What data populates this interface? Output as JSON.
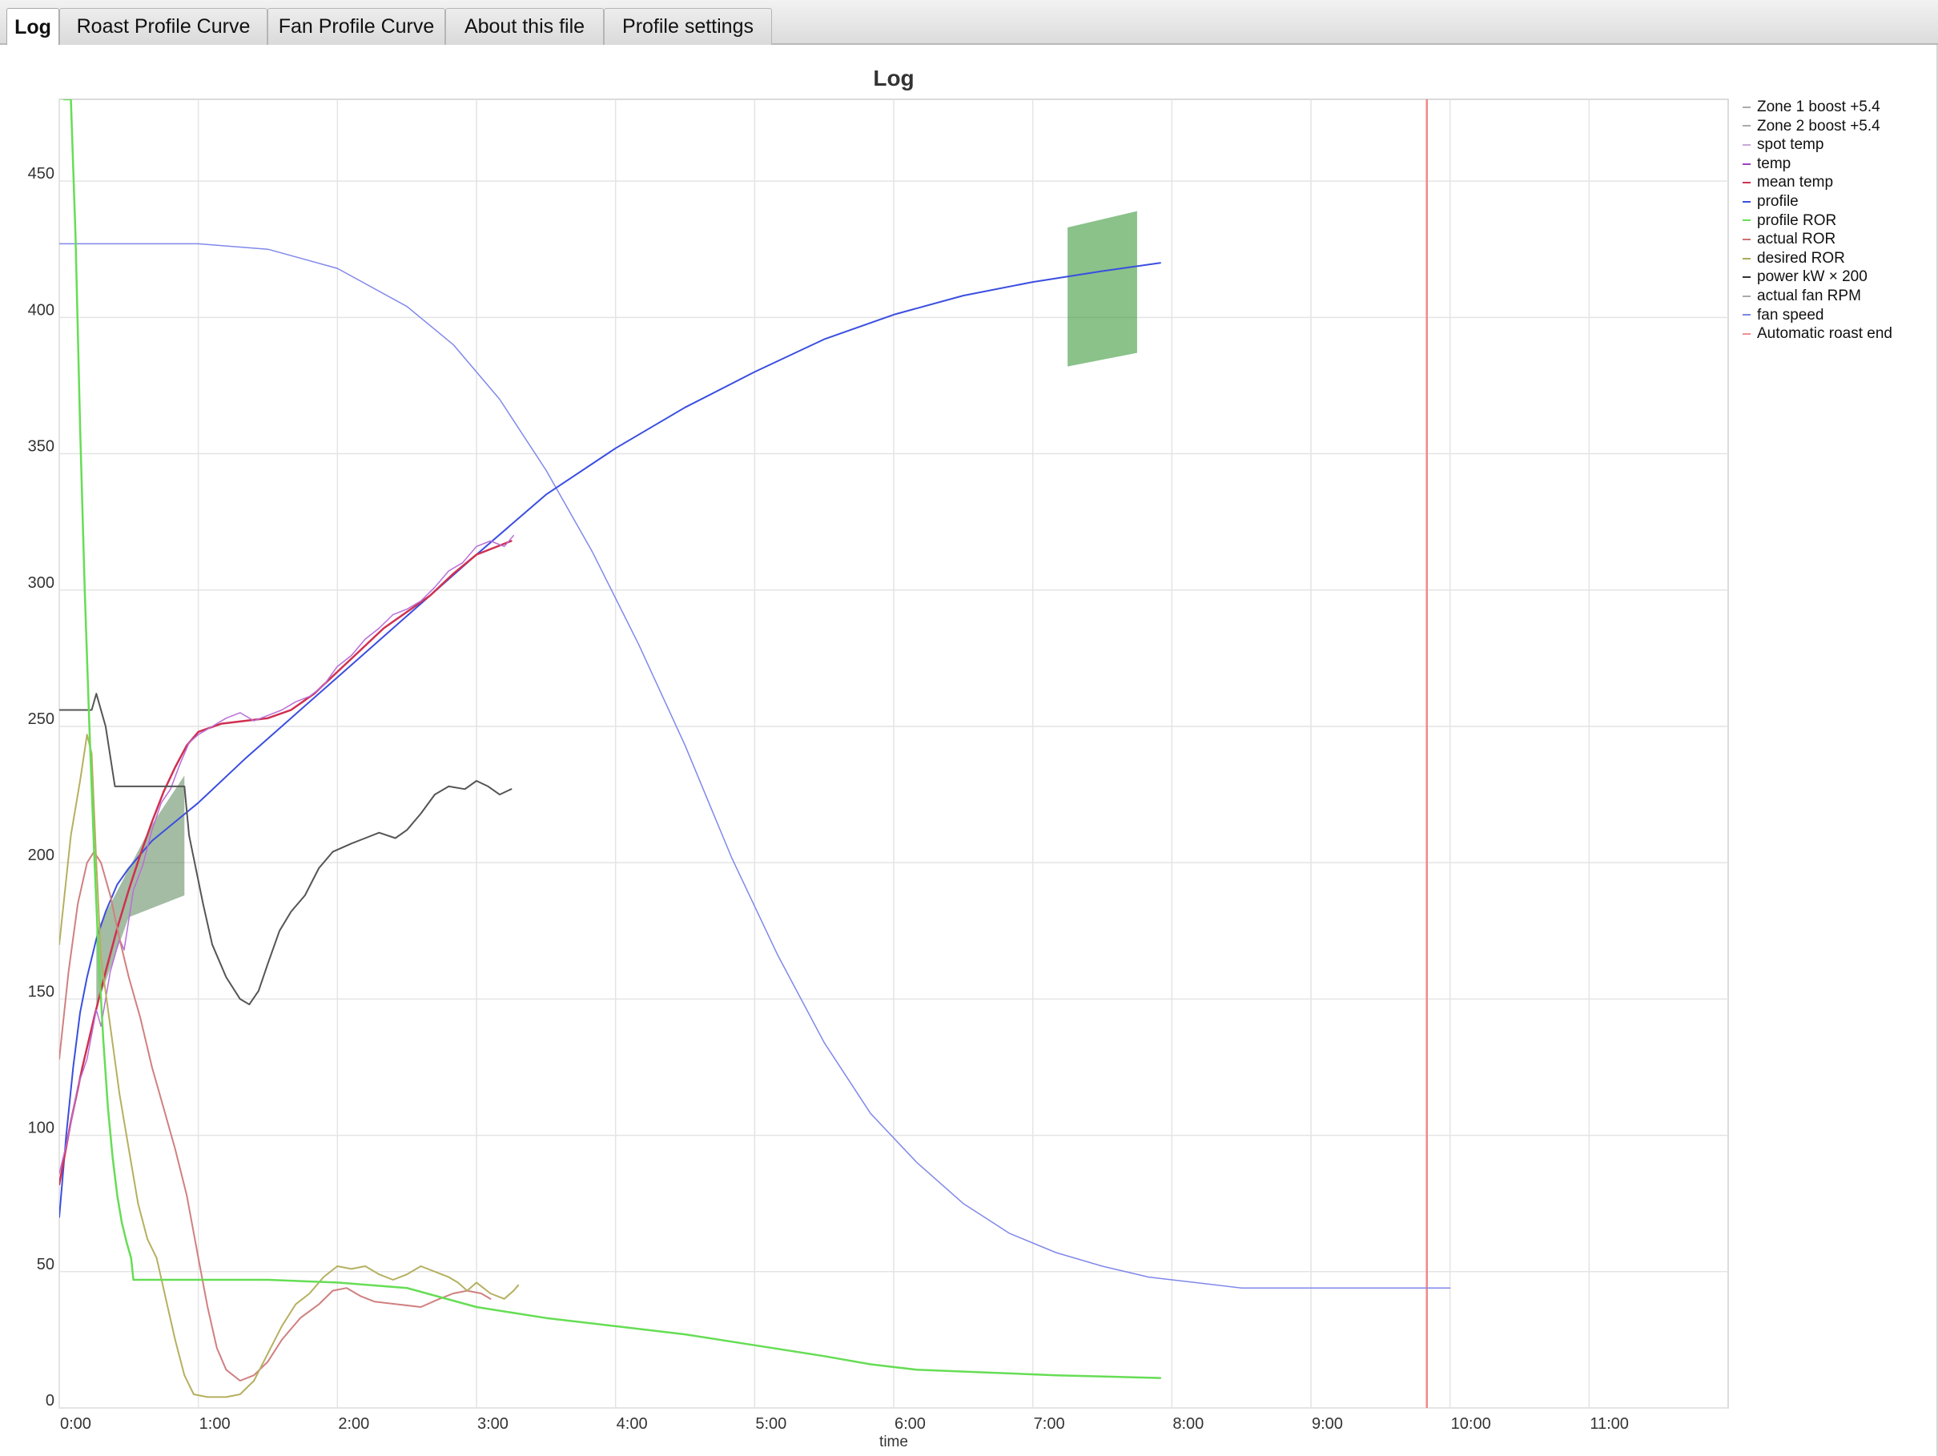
{
  "tabs": [
    {
      "label": "Log",
      "active": true
    },
    {
      "label": "Roast Profile Curve",
      "active": false
    },
    {
      "label": "Fan Profile Curve",
      "active": false
    },
    {
      "label": "About this file",
      "active": false
    },
    {
      "label": "Profile settings",
      "active": false
    }
  ],
  "chart_data": {
    "type": "line",
    "title": "Log",
    "xlabel": "time",
    "ylabel": "",
    "xlim": [
      0,
      720
    ],
    "ylim": [
      0,
      480
    ],
    "grid": true,
    "legend_position": "right",
    "xticks": [
      {
        "v": 0,
        "label": "0:00"
      },
      {
        "v": 60,
        "label": "1:00"
      },
      {
        "v": 120,
        "label": "2:00"
      },
      {
        "v": 180,
        "label": "3:00"
      },
      {
        "v": 240,
        "label": "4:00"
      },
      {
        "v": 300,
        "label": "5:00"
      },
      {
        "v": 360,
        "label": "6:00"
      },
      {
        "v": 420,
        "label": "7:00"
      },
      {
        "v": 480,
        "label": "8:00"
      },
      {
        "v": 540,
        "label": "9:00"
      },
      {
        "v": 600,
        "label": "10:00"
      },
      {
        "v": 660,
        "label": "11:00"
      }
    ],
    "yticks": [
      0,
      50,
      100,
      150,
      200,
      250,
      300,
      350,
      400,
      450
    ],
    "legend": [
      {
        "name": "Zone 1 boost +5.4",
        "color": "#aaaaaa"
      },
      {
        "name": "Zone 2 boost +5.4",
        "color": "#aaaaaa"
      },
      {
        "name": "spot temp",
        "color": "#c9a8d6"
      },
      {
        "name": "temp",
        "color": "#a040c0"
      },
      {
        "name": "mean temp",
        "color": "#d03050"
      },
      {
        "name": "profile",
        "color": "#3a4ee0"
      },
      {
        "name": "profile ROR",
        "color": "#66dd55"
      },
      {
        "name": "actual ROR",
        "color": "#d07070"
      },
      {
        "name": "desired ROR",
        "color": "#aaaa55"
      },
      {
        "name": "power kW × 200",
        "color": "#333333"
      },
      {
        "name": "actual fan RPM",
        "color": "#aaaaaa"
      },
      {
        "name": "fan speed",
        "color": "#7b84e6"
      },
      {
        "name": "Automatic roast end",
        "color": "#f09090"
      }
    ],
    "series": [
      {
        "name": "fan speed",
        "color": "#8088ea",
        "width": 1.5,
        "points": [
          [
            0,
            427
          ],
          [
            60,
            427
          ],
          [
            90,
            425
          ],
          [
            120,
            418
          ],
          [
            150,
            404
          ],
          [
            170,
            390
          ],
          [
            190,
            370
          ],
          [
            210,
            344
          ],
          [
            230,
            314
          ],
          [
            250,
            280
          ],
          [
            270,
            243
          ],
          [
            290,
            202
          ],
          [
            310,
            166
          ],
          [
            330,
            134
          ],
          [
            350,
            108
          ],
          [
            370,
            90
          ],
          [
            390,
            75
          ],
          [
            410,
            64
          ],
          [
            430,
            57
          ],
          [
            450,
            52
          ],
          [
            470,
            48
          ],
          [
            490,
            46
          ],
          [
            510,
            44
          ],
          [
            530,
            44
          ],
          [
            560,
            44
          ],
          [
            600,
            44
          ]
        ]
      },
      {
        "name": "profile",
        "color": "#3a4ee0",
        "width": 2,
        "points": [
          [
            0,
            70
          ],
          [
            3,
            100
          ],
          [
            6,
            125
          ],
          [
            9,
            145
          ],
          [
            12,
            158
          ],
          [
            16,
            172
          ],
          [
            20,
            182
          ],
          [
            25,
            192
          ],
          [
            30,
            198
          ],
          [
            40,
            208
          ],
          [
            60,
            222
          ],
          [
            80,
            238
          ],
          [
            100,
            253
          ],
          [
            120,
            268
          ],
          [
            140,
            283
          ],
          [
            160,
            298
          ],
          [
            180,
            313
          ],
          [
            210,
            335
          ],
          [
            240,
            352
          ],
          [
            270,
            367
          ],
          [
            300,
            380
          ],
          [
            330,
            392
          ],
          [
            360,
            401
          ],
          [
            390,
            408
          ],
          [
            420,
            413
          ],
          [
            450,
            417
          ],
          [
            475,
            420
          ]
        ]
      },
      {
        "name": "mean temp",
        "color": "#d03050",
        "width": 2.5,
        "points": [
          [
            0,
            82
          ],
          [
            5,
            105
          ],
          [
            10,
            125
          ],
          [
            15,
            143
          ],
          [
            20,
            160
          ],
          [
            25,
            176
          ],
          [
            30,
            190
          ],
          [
            35,
            203
          ],
          [
            40,
            215
          ],
          [
            45,
            226
          ],
          [
            50,
            235
          ],
          [
            55,
            243
          ],
          [
            60,
            248
          ],
          [
            70,
            251
          ],
          [
            80,
            252
          ],
          [
            90,
            253
          ],
          [
            100,
            256
          ],
          [
            110,
            262
          ],
          [
            120,
            270
          ],
          [
            130,
            278
          ],
          [
            140,
            286
          ],
          [
            150,
            292
          ],
          [
            160,
            298
          ],
          [
            170,
            306
          ],
          [
            180,
            313
          ],
          [
            195,
            318
          ]
        ]
      },
      {
        "name": "spot temp",
        "color": "#b86ed8",
        "width": 1.5,
        "points": [
          [
            0,
            86
          ],
          [
            4,
            100
          ],
          [
            8,
            118
          ],
          [
            12,
            128
          ],
          [
            16,
            146
          ],
          [
            18,
            140
          ],
          [
            22,
            160
          ],
          [
            26,
            172
          ],
          [
            28,
            168
          ],
          [
            32,
            190
          ],
          [
            36,
            199
          ],
          [
            40,
            212
          ],
          [
            44,
            222
          ],
          [
            48,
            227
          ],
          [
            52,
            236
          ],
          [
            56,
            244
          ],
          [
            60,
            247
          ],
          [
            66,
            250
          ],
          [
            72,
            253
          ],
          [
            78,
            255
          ],
          [
            84,
            252
          ],
          [
            90,
            254
          ],
          [
            96,
            256
          ],
          [
            102,
            259
          ],
          [
            108,
            261
          ],
          [
            114,
            265
          ],
          [
            120,
            272
          ],
          [
            126,
            276
          ],
          [
            132,
            282
          ],
          [
            138,
            286
          ],
          [
            144,
            291
          ],
          [
            150,
            293
          ],
          [
            156,
            296
          ],
          [
            162,
            301
          ],
          [
            168,
            307
          ],
          [
            174,
            310
          ],
          [
            180,
            316
          ],
          [
            186,
            318
          ],
          [
            192,
            316
          ],
          [
            196,
            320
          ]
        ]
      },
      {
        "name": "power kW × 200",
        "color": "#555555",
        "width": 2,
        "points": [
          [
            0,
            256
          ],
          [
            14,
            256
          ],
          [
            16,
            262
          ],
          [
            20,
            250
          ],
          [
            24,
            228
          ],
          [
            54,
            228
          ],
          [
            56,
            210
          ],
          [
            62,
            185
          ],
          [
            66,
            170
          ],
          [
            72,
            158
          ],
          [
            78,
            150
          ],
          [
            82,
            148
          ],
          [
            86,
            153
          ],
          [
            90,
            163
          ],
          [
            95,
            175
          ],
          [
            100,
            182
          ],
          [
            106,
            188
          ],
          [
            112,
            198
          ],
          [
            118,
            204
          ],
          [
            126,
            207
          ],
          [
            132,
            209
          ],
          [
            138,
            211
          ],
          [
            145,
            209
          ],
          [
            150,
            212
          ],
          [
            156,
            218
          ],
          [
            162,
            225
          ],
          [
            168,
            228
          ],
          [
            175,
            227
          ],
          [
            180,
            230
          ],
          [
            185,
            228
          ],
          [
            190,
            225
          ],
          [
            195,
            227
          ]
        ]
      },
      {
        "name": "actual ROR",
        "color": "#d08080",
        "width": 2,
        "points": [
          [
            0,
            128
          ],
          [
            4,
            160
          ],
          [
            8,
            185
          ],
          [
            12,
            200
          ],
          [
            15,
            204
          ],
          [
            18,
            200
          ],
          [
            22,
            188
          ],
          [
            26,
            172
          ],
          [
            30,
            158
          ],
          [
            35,
            143
          ],
          [
            40,
            125
          ],
          [
            45,
            110
          ],
          [
            50,
            95
          ],
          [
            55,
            78
          ],
          [
            60,
            55
          ],
          [
            64,
            37
          ],
          [
            68,
            22
          ],
          [
            72,
            14
          ],
          [
            78,
            10
          ],
          [
            84,
            12
          ],
          [
            90,
            17
          ],
          [
            96,
            25
          ],
          [
            104,
            33
          ],
          [
            112,
            38
          ],
          [
            118,
            43
          ],
          [
            124,
            44
          ],
          [
            130,
            41
          ],
          [
            136,
            39
          ],
          [
            146,
            38
          ],
          [
            156,
            37
          ],
          [
            164,
            40
          ],
          [
            170,
            42
          ],
          [
            176,
            43
          ],
          [
            182,
            42
          ],
          [
            186,
            40
          ]
        ]
      },
      {
        "name": "desired ROR",
        "color": "#b5b060",
        "width": 2,
        "points": [
          [
            0,
            170
          ],
          [
            5,
            210
          ],
          [
            9,
            230
          ],
          [
            12,
            247
          ],
          [
            14,
            240
          ],
          [
            16,
            200
          ],
          [
            18,
            165
          ],
          [
            22,
            140
          ],
          [
            26,
            115
          ],
          [
            30,
            95
          ],
          [
            34,
            75
          ],
          [
            38,
            62
          ],
          [
            42,
            55
          ],
          [
            46,
            40
          ],
          [
            50,
            25
          ],
          [
            54,
            12
          ],
          [
            58,
            5
          ],
          [
            64,
            4
          ],
          [
            72,
            4
          ],
          [
            78,
            5
          ],
          [
            84,
            10
          ],
          [
            90,
            20
          ],
          [
            96,
            30
          ],
          [
            102,
            38
          ],
          [
            108,
            42
          ],
          [
            114,
            48
          ],
          [
            120,
            52
          ],
          [
            126,
            51
          ],
          [
            132,
            52
          ],
          [
            138,
            49
          ],
          [
            144,
            47
          ],
          [
            150,
            49
          ],
          [
            156,
            52
          ],
          [
            162,
            50
          ],
          [
            168,
            48
          ],
          [
            172,
            46
          ],
          [
            176,
            43
          ],
          [
            180,
            46
          ],
          [
            186,
            42
          ],
          [
            192,
            40
          ],
          [
            196,
            43
          ],
          [
            198,
            45
          ]
        ]
      },
      {
        "name": "profile ROR",
        "color": "#66dd55",
        "width": 2.5,
        "points": [
          [
            2,
            480
          ],
          [
            5,
            480
          ],
          [
            7,
            430
          ],
          [
            9,
            360
          ],
          [
            11,
            300
          ],
          [
            13,
            250
          ],
          [
            15,
            205
          ],
          [
            17,
            165
          ],
          [
            19,
            135
          ],
          [
            21,
            110
          ],
          [
            23,
            92
          ],
          [
            25,
            78
          ],
          [
            27,
            68
          ],
          [
            29,
            61
          ],
          [
            31,
            55
          ],
          [
            32,
            47
          ],
          [
            60,
            47
          ],
          [
            90,
            47
          ],
          [
            120,
            46
          ],
          [
            150,
            44
          ],
          [
            180,
            37
          ],
          [
            210,
            33
          ],
          [
            240,
            30
          ],
          [
            270,
            27
          ],
          [
            300,
            23
          ],
          [
            330,
            19
          ],
          [
            350,
            16
          ],
          [
            370,
            14
          ],
          [
            400,
            13
          ],
          [
            430,
            12
          ],
          [
            475,
            11
          ]
        ]
      }
    ],
    "bands": [
      {
        "color": "#4a7a4a",
        "opacity": 0.5,
        "points": [
          [
            16,
            147
          ],
          [
            30,
            180
          ],
          [
            54,
            188
          ],
          [
            54,
            232
          ],
          [
            40,
            214
          ],
          [
            16,
            175
          ]
        ]
      },
      {
        "color": "#3c9a3c",
        "opacity": 0.6,
        "points": [
          [
            435,
            382
          ],
          [
            465,
            387
          ],
          [
            465,
            439
          ],
          [
            435,
            433
          ]
        ]
      }
    ],
    "vline": {
      "x": 590,
      "color": "#f08888"
    }
  }
}
